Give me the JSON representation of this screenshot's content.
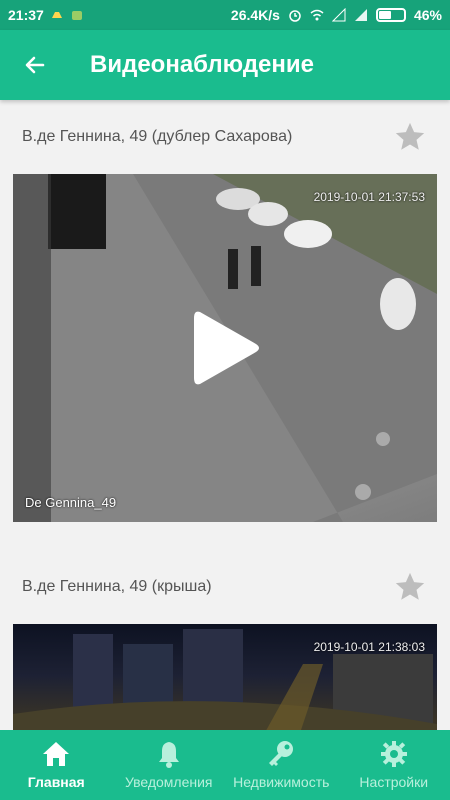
{
  "status_bar": {
    "time": "21:37",
    "speed": "26.4K/s",
    "battery": "46%"
  },
  "app_bar": {
    "title": "Видеонаблюдение"
  },
  "cameras": [
    {
      "title": "В.де Геннина, 49 (дублер Сахарова)",
      "timestamp": "2019-10-01 21:37:53",
      "label": "De Gennina_49"
    },
    {
      "title": "В.де Геннина, 49 (крыша)",
      "timestamp": "2019-10-01 21:38:03"
    }
  ],
  "bottom_nav": {
    "items": [
      {
        "label": "Главная",
        "icon": "home-icon",
        "active": true
      },
      {
        "label": "Уведомления",
        "icon": "bell-icon",
        "active": false
      },
      {
        "label": "Недвижимость",
        "icon": "key-icon",
        "active": false
      },
      {
        "label": "Настройки",
        "icon": "gear-icon",
        "active": false
      }
    ]
  },
  "colors": {
    "primary": "#1abc8e",
    "status_bar": "#17a37a",
    "inactive_nav": "#b8f0dc"
  }
}
